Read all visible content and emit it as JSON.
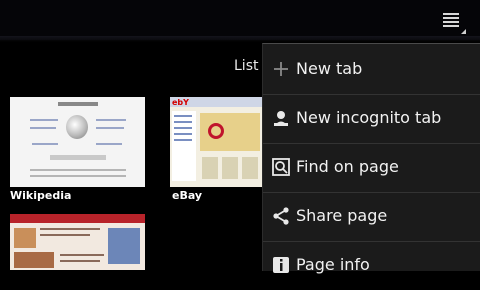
{
  "header": {
    "menu_icon": "overflow-menu-icon"
  },
  "view_toggle": {
    "label": "List"
  },
  "thumbnails": [
    {
      "title": "Wikipedia"
    },
    {
      "title": "eBay"
    },
    {
      "title": ""
    }
  ],
  "menu": {
    "items": [
      {
        "label": "New tab",
        "icon": "plus-icon"
      },
      {
        "label": "New incognito tab",
        "icon": "incognito-icon"
      },
      {
        "label": "Find on page",
        "icon": "find-icon"
      },
      {
        "label": "Share page",
        "icon": "share-icon"
      },
      {
        "label": "Page info",
        "icon": "info-icon"
      }
    ]
  },
  "colors": {
    "background": "#000000",
    "menu_background": "#1b1b1b",
    "menu_text": "#f2f2f2"
  }
}
